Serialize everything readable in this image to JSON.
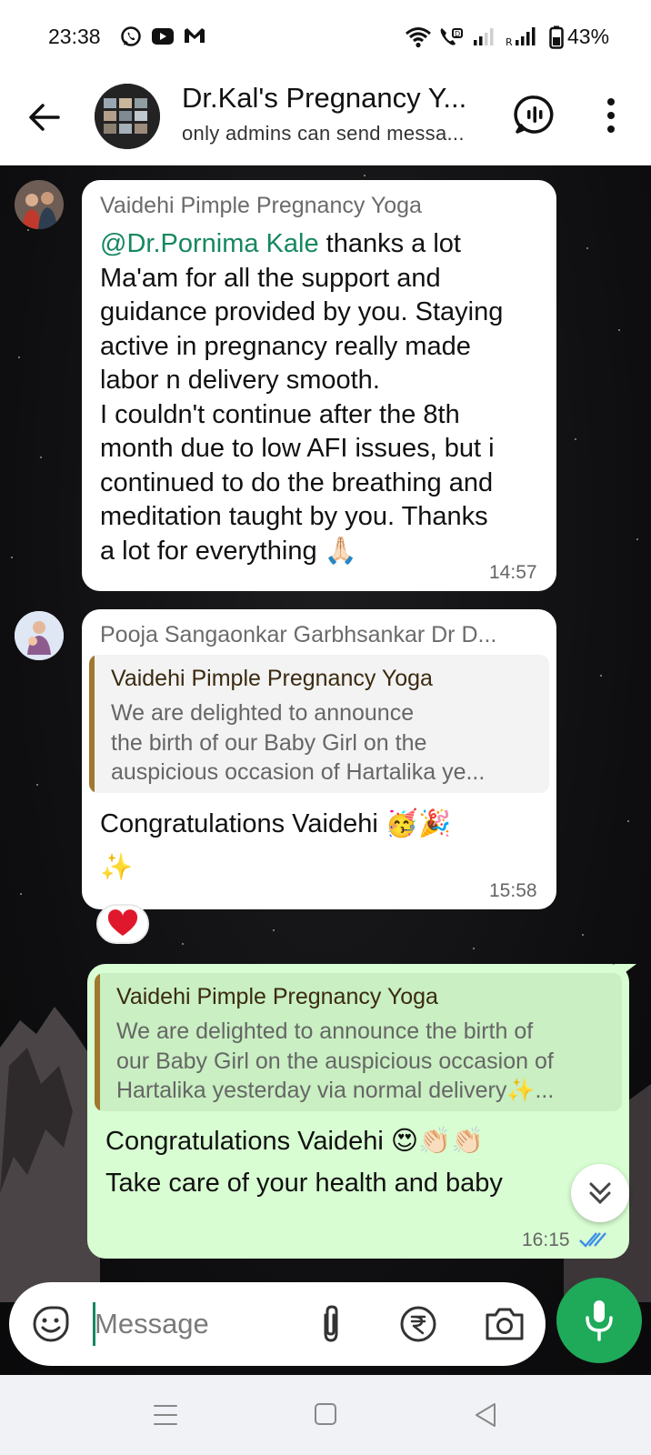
{
  "status_bar": {
    "time": "23:38",
    "battery": "43%",
    "icons": [
      "whatsapp-icon",
      "youtube-icon",
      "gmail-icon",
      "wifi-icon",
      "volte-call-icon",
      "signal-icon",
      "roaming-signal-icon",
      "battery-icon"
    ]
  },
  "header": {
    "title": "Dr.Kal's Pregnancy Y...",
    "subtitle": "only admins can send messa..."
  },
  "messages": [
    {
      "sender": "Vaidehi Pimple Pregnancy Yoga",
      "mention": "@Dr.Pornima Kale",
      "lines": [
        " thanks a lot",
        "Ma'am for all the support and",
        "guidance provided by you. Staying",
        "active in pregnancy really made",
        "labor n delivery smooth.",
        "I couldn't continue after the 8th",
        "month due to low AFI issues, but i",
        "continued to do the breathing and",
        "meditation taught by you. Thanks",
        "a lot for everything 🙏🏻"
      ],
      "time": "14:57"
    },
    {
      "sender": "Pooja Sangaonkar Garbhsankar Dr D...",
      "quote_author": "Vaidehi Pimple Pregnancy Yoga",
      "quote_lines": [
        "We are delighted to announce",
        "the birth of our Baby Girl on the",
        "auspicious occasion of Hartalika ye..."
      ],
      "lines": [
        "Congratulations Vaidehi 🥳🎉",
        "✨"
      ],
      "time": "15:58",
      "reaction": "❤️"
    },
    {
      "quote_author": "Vaidehi Pimple Pregnancy Yoga",
      "quote_lines": [
        "We are delighted to announce the birth of",
        "our Baby Girl on the auspicious occasion of",
        "Hartalika yesterday via normal delivery✨..."
      ],
      "lines": [
        "Congratulations Vaidehi 😍👏🏻👏🏻",
        "Take care of your health and baby"
      ],
      "time": "16:15",
      "status": "✓✓"
    }
  ],
  "composer": {
    "placeholder": "Message"
  },
  "colors": {
    "accent_green": "#1faa5a",
    "mention_green": "#16875e",
    "outgoing_bubble": "#d8fdd2",
    "read_tick_blue": "#3b8ee8"
  }
}
